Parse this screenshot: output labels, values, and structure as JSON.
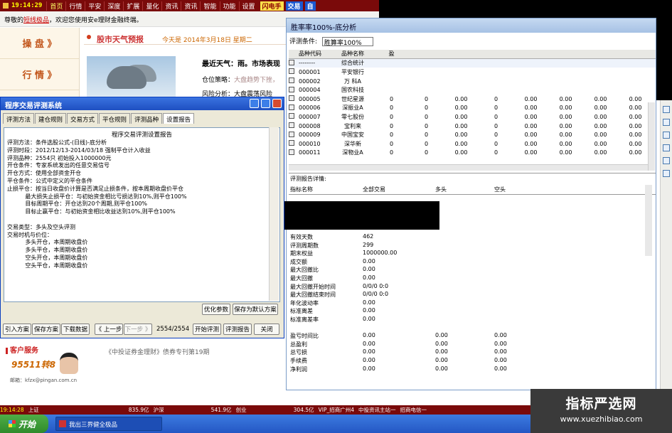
{
  "topbar": {
    "time": "19:14:29",
    "menus": [
      "首页",
      "行情",
      "平安",
      "深度",
      "扩展",
      "量化",
      "资讯",
      "资讯",
      "智能",
      "功能",
      "设置"
    ],
    "highlight_menu": "首页",
    "btn_yellow": "闪电手",
    "btn_blue": "交易",
    "btn_extra": "自"
  },
  "welcome": {
    "prefix": "尊敬的",
    "link": "短线极品",
    "suffix": "，欢迎您使用安e理财金融终端。"
  },
  "leftnav": {
    "items": [
      "操 盘 》",
      "行 情 》"
    ]
  },
  "content": {
    "title": "股市天气预报",
    "date": "今天是 2014年3月18日 星期二",
    "weather_label": "最近天气：",
    "weather_text": "雨。市场表现",
    "strategy_label": "仓位策略：",
    "strategy_text": "大盘趋势下挫，",
    "risk_text": "风险分析：大盘震荡风险"
  },
  "stock_window": {
    "title": "胜率率100%-底分析",
    "condition_label": "评测条件:",
    "condition_value": "胜算率100%",
    "columns": [
      "品种代码",
      "品种名称",
      "盈",
      "",
      "",
      "",
      "",
      "",
      "",
      ""
    ],
    "rows": [
      {
        "code": "--------",
        "name": "综合统计",
        "vals": [
          "",
          "",
          "",
          "",
          "",
          "",
          "",
          ""
        ]
      },
      {
        "code": "000001",
        "name": "平安银行",
        "vals": [
          "",
          "",
          "",
          "",
          "",
          "",
          "",
          ""
        ]
      },
      {
        "code": "000002",
        "name": "万  科A",
        "vals": [
          "",
          "",
          "",
          "",
          "",
          "",
          "",
          ""
        ]
      },
      {
        "code": "000004",
        "name": "国农科技",
        "vals": [
          "",
          "",
          "",
          "",
          "",
          "",
          "",
          ""
        ]
      },
      {
        "code": "000005",
        "name": "世纪星源",
        "vals": [
          "0",
          "0",
          "0.00",
          "0",
          "0.00",
          "0.00",
          "0.00",
          "0.00"
        ]
      },
      {
        "code": "000006",
        "name": "深振业A",
        "vals": [
          "0",
          "0",
          "0.00",
          "0",
          "0.00",
          "0.00",
          "0.00",
          "0.00"
        ]
      },
      {
        "code": "000007",
        "name": "零七股份",
        "vals": [
          "0",
          "0",
          "0.00",
          "0",
          "0.00",
          "0.00",
          "0.00",
          "0.00"
        ]
      },
      {
        "code": "000008",
        "name": "宝利来",
        "vals": [
          "0",
          "0",
          "0.00",
          "0",
          "0.00",
          "0.00",
          "0.00",
          "0.00"
        ]
      },
      {
        "code": "000009",
        "name": "中国宝安",
        "vals": [
          "0",
          "0",
          "0.00",
          "0",
          "0.00",
          "0.00",
          "0.00",
          "0.00"
        ]
      },
      {
        "code": "000010",
        "name": "深华新",
        "vals": [
          "0",
          "0",
          "0.00",
          "0",
          "0.00",
          "0.00",
          "0.00",
          "0.00"
        ]
      },
      {
        "code": "000011",
        "name": "深物业A",
        "vals": [
          "0",
          "0",
          "0.00",
          "0",
          "0.00",
          "0.00",
          "0.00",
          "0.00"
        ]
      }
    ],
    "detail_title": "评测报告详情:",
    "detail_columns": [
      "指标名称",
      "全部交易",
      "多头",
      "空头"
    ],
    "detail_rows": [
      {
        "k": "有效天数",
        "a": "462",
        "b": "",
        "c": ""
      },
      {
        "k": "评测周期数",
        "a": "299",
        "b": "",
        "c": ""
      },
      {
        "k": "期末权益",
        "a": "1000000.00",
        "b": "",
        "c": ""
      },
      {
        "k": "成交额",
        "a": "0.00",
        "b": "",
        "c": ""
      },
      {
        "k": "最大回撤比",
        "a": "0.00",
        "b": "",
        "c": ""
      },
      {
        "k": "最大回撤",
        "a": "0.00",
        "b": "",
        "c": ""
      },
      {
        "k": "最大回撤开始时间",
        "a": "0/0/0 0:0",
        "b": "",
        "c": ""
      },
      {
        "k": "最大回撤结束时间",
        "a": "0/0/0 0:0",
        "b": "",
        "c": ""
      },
      {
        "k": "年化波动率",
        "a": "0.00",
        "b": "",
        "c": ""
      },
      {
        "k": "标准离差",
        "a": "0.00",
        "b": "",
        "c": ""
      },
      {
        "k": "标准离差率",
        "a": "0.00",
        "b": "",
        "c": ""
      },
      {
        "k": "",
        "a": "",
        "b": "",
        "c": ""
      },
      {
        "k": "盈亏时间比",
        "a": "0.00",
        "b": "0.00",
        "c": "0.00"
      },
      {
        "k": "总盈利",
        "a": "0.00",
        "b": "0.00",
        "c": "0.00"
      },
      {
        "k": "总亏损",
        "a": "0.00",
        "b": "0.00",
        "c": "0.00"
      },
      {
        "k": "手续费",
        "a": "0.00",
        "b": "0.00",
        "c": "0.00"
      },
      {
        "k": "净利润",
        "a": "0.00",
        "b": "0.00",
        "c": "0.00"
      }
    ]
  },
  "dialog": {
    "title": "程序交易评测系统",
    "tabs": [
      "评测方法",
      "建仓规则",
      "交易方式",
      "平仓规则",
      "评测品种",
      "设置报告"
    ],
    "active_tab": "设置报告",
    "report_title": "程序交易评测设置报告",
    "report_lines": [
      "评测方法：条件选股公式-(日线)-底分析",
      "评测时段：2012/12/13-2014/03/18 强制平仓计入收益",
      "评测品种：2554只 初始投入1000000元",
      "开仓条件：专家系统发出的任意交易信号",
      "开仓方式：使用全部资金开仓",
      "平仓条件：公式中定义的平仓条件",
      "止损平仓：按当日收盘价计算是否满足止损条件，按本周期收盘价平仓",
      "          最大损失止损平仓：与初始资金相比亏损达到10%,则平仓100%",
      "          目标周期平仓：开仓达到20个周期,则平仓100%",
      "          目标止赢平仓：与初始资金相比收益达到10%,则平仓100%",
      "",
      "交易类型：多头及空头评测",
      "交易时机与价位：",
      "          多头开仓，本周期收盘价",
      "          多头平仓，本周期收盘价",
      "          空头开仓，本周期收盘价",
      "          空头平仓，本周期收盘价"
    ],
    "btn_optimize": "优化参数",
    "btn_save_default": "保存为默认方案",
    "btn_import": "引入方案",
    "btn_save": "保存方案",
    "btn_download": "下载数据",
    "btn_prev": "《 上一步",
    "btn_next": "下一步 》",
    "page_info": "2554/2554",
    "btn_start": "开始评测",
    "btn_report": "评测报告",
    "btn_close": "关闭"
  },
  "customer_service": {
    "title": "客户服务",
    "phone": "95511转8",
    "mail": "邮箱：kfzx@pingan.com.cn"
  },
  "bond_text": "《中投证券金理财》债券专刊第19期",
  "ticker": {
    "time": "19:14:28",
    "items": [
      "上证",
      "835.9亿",
      "沪深",
      "541.9亿",
      "创业",
      "304.5亿",
      "VIP_招商广州4",
      "中投资讯主站一",
      "招商电信一"
    ]
  },
  "taskbar": {
    "start": "开始",
    "task": "我出三界健全极品"
  },
  "watermark": {
    "line1": "指标严选网",
    "line2": "www.xuezhibiao.com"
  }
}
